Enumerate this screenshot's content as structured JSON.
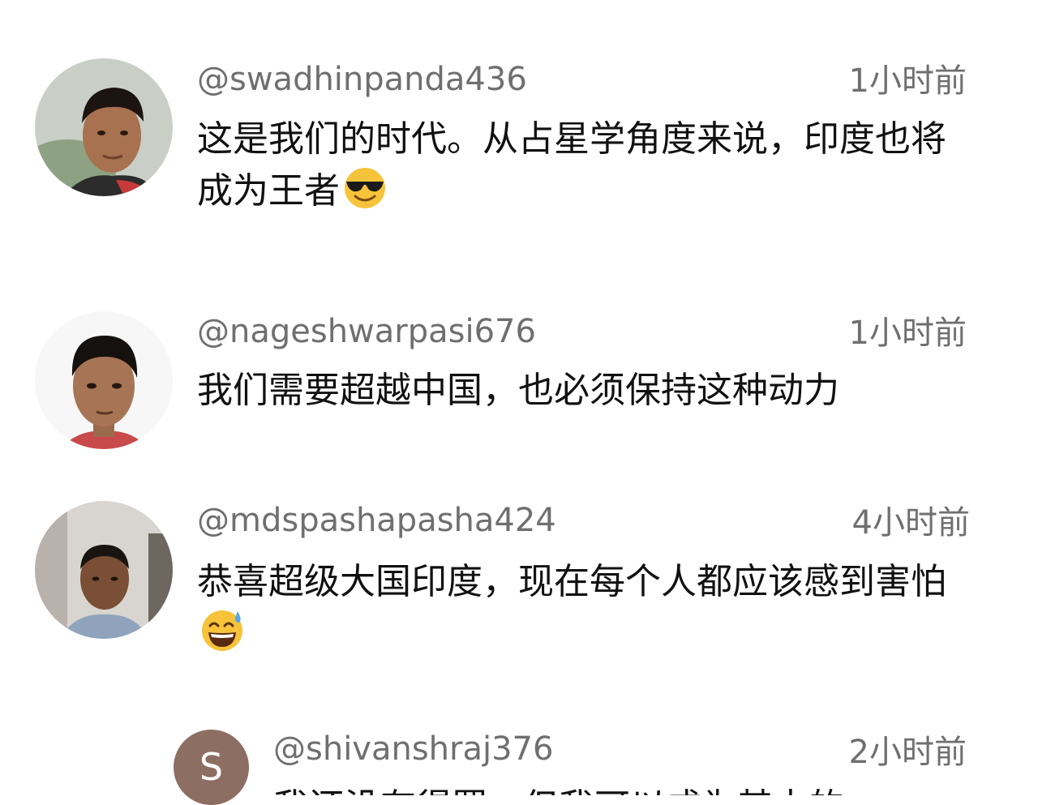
{
  "comments": [
    {
      "username": "@swadhinpanda436",
      "time": "1小时前",
      "text": "这是我们的时代。从占星学角度来说，印度也将成为王者",
      "emoji": "smiling-face-with-sunglasses-icon"
    },
    {
      "username": "@nageshwarpasi676",
      "time": "1小时前",
      "text": "我们需要超越中国，也必须保持这种动力"
    },
    {
      "username": "@mdspashapasha424",
      "time": "4小时前",
      "text": "恭喜超级大国印度，现在每个人都应该感到害怕",
      "emoji": "grinning-face-with-sweat-icon"
    },
    {
      "username": "@shivanshraj376",
      "time": "2小时前",
      "avatar_letter": "S",
      "avatar_color": "#8d6e63",
      "text": "我还没有得罪，但我可以成为其中的"
    }
  ]
}
